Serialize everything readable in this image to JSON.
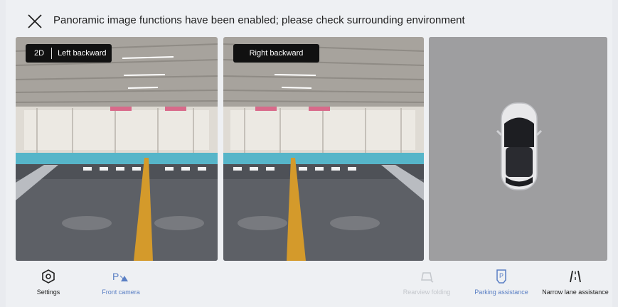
{
  "header": {
    "close_icon": "close-icon",
    "title": "Panoramic image functions have been enabled; please check surrounding environment"
  },
  "views": [
    {
      "mode": "2D",
      "label": "Left backward"
    },
    {
      "label": "Right backward"
    },
    {
      "label": ""
    }
  ],
  "functions": [
    {
      "label": "Settings",
      "icon": "settings-icon",
      "color": "#222222",
      "enabled": true
    },
    {
      "label": "Front camera",
      "icon": "front-camera-icon",
      "color": "#5a7fc4",
      "enabled": true
    },
    {
      "label": "Rearview folding",
      "icon": "mirror-fold-icon",
      "color": "#c4c7cc",
      "enabled": false
    },
    {
      "label": "Parking assistance",
      "icon": "parking-assist-icon",
      "color": "#5a7fc4",
      "enabled": true
    },
    {
      "label": "Narrow lane assistance",
      "icon": "narrow-lane-icon",
      "color": "#222222",
      "enabled": true
    }
  ]
}
